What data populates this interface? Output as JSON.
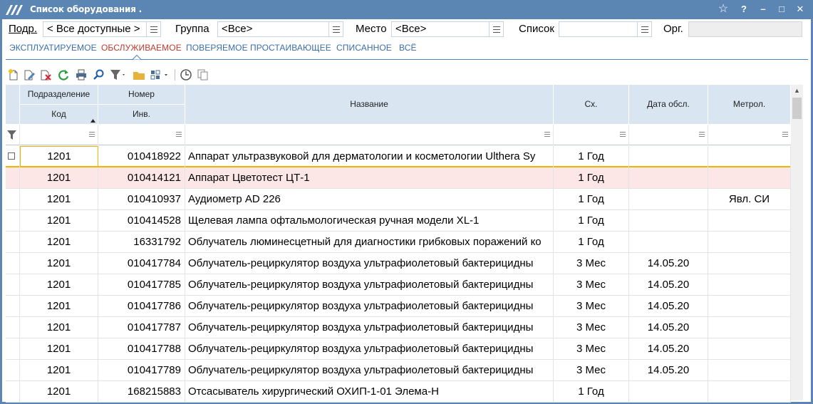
{
  "window": {
    "title": "Список оборудования .",
    "controls": {
      "favorite": "☆",
      "help": "?",
      "minimize": "–",
      "maximize": "□",
      "close": "✕"
    }
  },
  "filters": {
    "podr_label": "Подр.",
    "podr_value": "< Все доступные >",
    "gruppa_label": "Группа",
    "gruppa_value": "<Все>",
    "mesto_label": "Место",
    "mesto_value": "<Все>",
    "spisok_label": "Список",
    "spisok_value": "",
    "org_label": "Орг.",
    "org_value": ""
  },
  "tabs": [
    {
      "label": "ЭКСПЛУАТИРУЕМОЕ",
      "active": false
    },
    {
      "label": "ОБСЛУЖИВАЕМОЕ",
      "active": true
    },
    {
      "label": "ПОВЕРЯЕМОЕ",
      "active": false
    },
    {
      "label": "ПРОСТАИВАЮЩЕЕ",
      "active": false
    },
    {
      "label": "СПИСАННОЕ",
      "active": false
    },
    {
      "label": "ВСЁ",
      "active": false
    }
  ],
  "toolbar": {
    "icons": [
      "new-icon",
      "edit-icon",
      "delete-icon",
      "refresh-icon",
      "print-icon",
      "find-icon",
      "filter-icon",
      "folder-icon",
      "layout-icon",
      "clock-icon",
      "copy-icon"
    ]
  },
  "grid": {
    "headers": {
      "podrazdelenie": "Подразделение",
      "kod": "Код",
      "nomer": "Номер",
      "inv": "Инв.",
      "nazvanie": "Название",
      "sch": "Сх.",
      "data_obsl": "Дата обсл.",
      "metrol": "Метрол."
    },
    "sorted_column": "kod",
    "rows": [
      {
        "kod": "1201",
        "inv": "010418922",
        "name": "Аппарат ультразвуковой для дерматологии и косметологии Ulthera Sy",
        "sch": "1 Год",
        "date": "",
        "metr": ""
      },
      {
        "kod": "1201",
        "inv": "010414121",
        "name": "Аппарат Цветотест ЦТ-1",
        "sch": "1 Год",
        "date": "",
        "metr": ""
      },
      {
        "kod": "1201",
        "inv": "010410937",
        "name": "Аудиометр AD 226",
        "sch": "1 Год",
        "date": "",
        "metr": "Явл. СИ"
      },
      {
        "kod": "1201",
        "inv": "010414528",
        "name": "Щелевая лампа офтальмологическая ручная модели XL-1",
        "sch": "1 Год",
        "date": "",
        "metr": ""
      },
      {
        "kod": "1201",
        "inv": "16331792",
        "name": "Облучатель люминесцетный для диагностики грибковых поражений ко",
        "sch": "1 Год",
        "date": "",
        "metr": ""
      },
      {
        "kod": "1201",
        "inv": "010417784",
        "name": "Облучатель-рециркулятор воздуха ультрафиолетовый бактерицидны",
        "sch": "3 Мес",
        "date": "14.05.20",
        "metr": ""
      },
      {
        "kod": "1201",
        "inv": "010417785",
        "name": "Облучатель-рециркулятор воздуха ультрафиолетовый бактерицидны",
        "sch": "3 Мес",
        "date": "14.05.20",
        "metr": ""
      },
      {
        "kod": "1201",
        "inv": "010417786",
        "name": "Облучатель-рециркулятор воздуха ультрафиолетовый бактерицидны",
        "sch": "3 Мес",
        "date": "14.05.20",
        "metr": ""
      },
      {
        "kod": "1201",
        "inv": "010417787",
        "name": "Облучатель-рециркулятор воздуха ультрафиолетовый бактерицидны",
        "sch": "3 Мес",
        "date": "14.05.20",
        "metr": ""
      },
      {
        "kod": "1201",
        "inv": "010417788",
        "name": "Облучатель-рециркулятор воздуха ультрафиолетовый бактерицидны",
        "sch": "3 Мес",
        "date": "14.05.20",
        "metr": ""
      },
      {
        "kod": "1201",
        "inv": "010417789",
        "name": "Облучатель-рециркулятор воздуха ультрафиолетовый бактерицидны",
        "sch": "3 Мес",
        "date": "14.05.20",
        "metr": ""
      },
      {
        "kod": "1201",
        "inv": "168215883",
        "name": "Отсасыватель хирургический ОХИП-1-01 Элема-Н",
        "sch": "1 Год",
        "date": "",
        "metr": ""
      }
    ]
  },
  "colors": {
    "titlebar": "#5b86b4",
    "header_bg": "#d9e6f2",
    "tab_active": "#c0392b",
    "tab_inactive": "#3a6ea8",
    "highlight_row": "#fde6e6",
    "focus_border": "#f0b400"
  }
}
